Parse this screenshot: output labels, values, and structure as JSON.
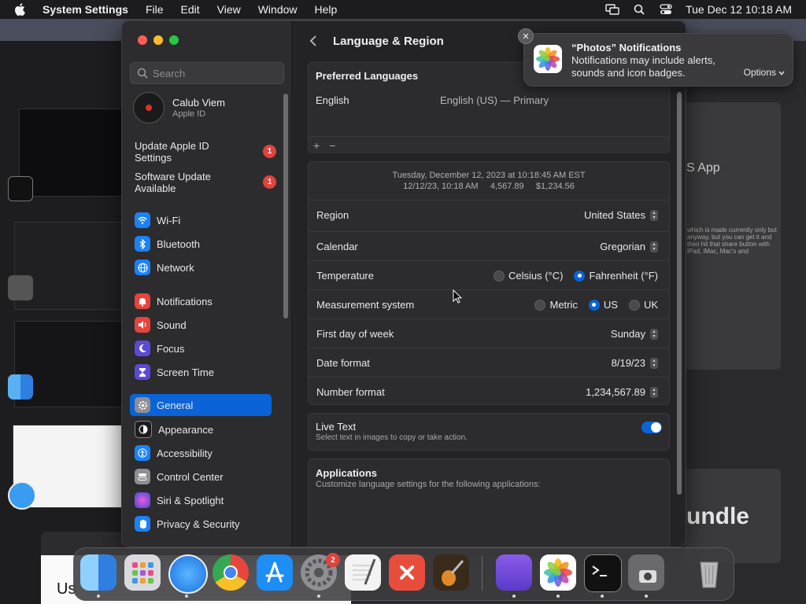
{
  "menubar": {
    "app": "System Settings",
    "items": [
      "File",
      "Edit",
      "View",
      "Window",
      "Help"
    ],
    "clock": "Tue Dec 12  10:18 AM"
  },
  "sidebar": {
    "search_placeholder": "Search",
    "user": {
      "name": "Calub Viem",
      "sub": "Apple ID"
    },
    "updates": [
      {
        "label": "Update Apple ID Settings",
        "badge": "1"
      },
      {
        "label": "Software Update Available",
        "badge": "1"
      }
    ],
    "items": [
      {
        "label": "Wi-Fi",
        "icon": "wifi-icon",
        "color": "#1a82f7"
      },
      {
        "label": "Bluetooth",
        "icon": "bluetooth-icon",
        "color": "#1a82f7"
      },
      {
        "label": "Network",
        "icon": "globe-icon",
        "color": "#1a82f7"
      },
      {
        "label": "Notifications",
        "icon": "bell-icon",
        "color": "#e5433b"
      },
      {
        "label": "Sound",
        "icon": "speaker-icon",
        "color": "#e5433b"
      },
      {
        "label": "Focus",
        "icon": "moon-icon",
        "color": "#5a4bd6"
      },
      {
        "label": "Screen Time",
        "icon": "hourglass-icon",
        "color": "#5a4bd6"
      },
      {
        "label": "General",
        "icon": "gear-icon",
        "color": "#8e8e93"
      },
      {
        "label": "Appearance",
        "icon": "appearance-icon",
        "color": "#1c1c1e"
      },
      {
        "label": "Accessibility",
        "icon": "accessibility-icon",
        "color": "#1a82f7"
      },
      {
        "label": "Control Center",
        "icon": "control-center-icon",
        "color": "#8e8e93"
      },
      {
        "label": "Siri & Spotlight",
        "icon": "siri-icon",
        "color": "#c03ad0"
      },
      {
        "label": "Privacy & Security",
        "icon": "hand-icon",
        "color": "#1a82f7"
      }
    ]
  },
  "content": {
    "title": "Language & Region",
    "preferred": {
      "title": "Preferred Languages",
      "lang": "English",
      "lang_detail": "English (US) — Primary",
      "add": "+",
      "remove": "−"
    },
    "format_preview": {
      "line1": "Tuesday, December 12, 2023 at 10:18:45 AM EST",
      "line2": "12/12/23, 10:18 AM     4,567.89     $1,234.56"
    },
    "rows": {
      "region": {
        "label": "Region",
        "value": "United States"
      },
      "calendar": {
        "label": "Calendar",
        "value": "Gregorian"
      },
      "temperature": {
        "label": "Temperature",
        "opt1": "Celsius (°C)",
        "opt2": "Fahrenheit (°F)"
      },
      "measurement": {
        "label": "Measurement system",
        "opt1": "Metric",
        "opt2": "US",
        "opt3": "UK"
      },
      "first_day": {
        "label": "First day of week",
        "value": "Sunday"
      },
      "date_format": {
        "label": "Date format",
        "value": "8/19/23"
      },
      "number_format": {
        "label": "Number format",
        "value": "1,234,567.89"
      }
    },
    "live_text": {
      "title": "Live Text",
      "desc": "Select text in images to copy or take action."
    },
    "applications": {
      "title": "Applications",
      "desc": "Customize language settings for the following applications:"
    }
  },
  "notification": {
    "title": "“Photos” Notifications",
    "body": "Notifications may include alerts, sounds and icon badges.",
    "options": "Options"
  },
  "background": {
    "right_text": "S App",
    "right_small": "which is made currently only but anyway, but you can get it and then hit that share button with iPad, iMac, Mac's and",
    "right2_text": "undle",
    "bottom_text": "Us"
  },
  "dock": {
    "settings_badge": "2"
  }
}
